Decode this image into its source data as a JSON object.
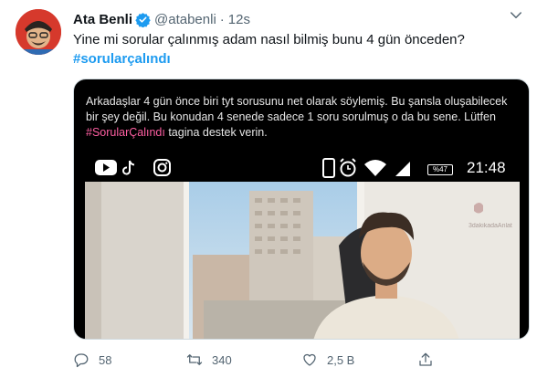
{
  "tweet": {
    "display_name": "Ata Benli",
    "handle": "@atabenli",
    "separator": "·",
    "time": "12s",
    "text": "Yine mi sorular çalınmış adam nasıl bilmiş bunu 4 gün önceden?",
    "hashtag": "#sorularçalındı"
  },
  "media": {
    "caption_line1": "Arkadaşlar 4 gün önce biri tyt sorusunu net olarak söylemiş. Bu şansla oluşabilecek",
    "caption_line2": "bir şey değil. Bu konudan 4 senede sadece 1 soru sorulmuş o da bu sene. Lütfen",
    "caption_hashtag": "#SorularÇalındı",
    "caption_tail": " tagina destek verin.",
    "phone_clock": "21:48",
    "battery": "%47",
    "watermark": "3dakikadaAnlat"
  },
  "actions": {
    "replies": "58",
    "retweets": "340",
    "likes": "2,5 B"
  },
  "colors": {
    "accent": "#1d9bf0",
    "muted": "#536471",
    "hashtag_pink": "#ff5fa2"
  },
  "icons": {
    "verified": "verified-badge-icon",
    "more": "chevron-down-icon",
    "reply": "reply-icon",
    "retweet": "retweet-icon",
    "like": "heart-icon",
    "share": "share-icon"
  }
}
